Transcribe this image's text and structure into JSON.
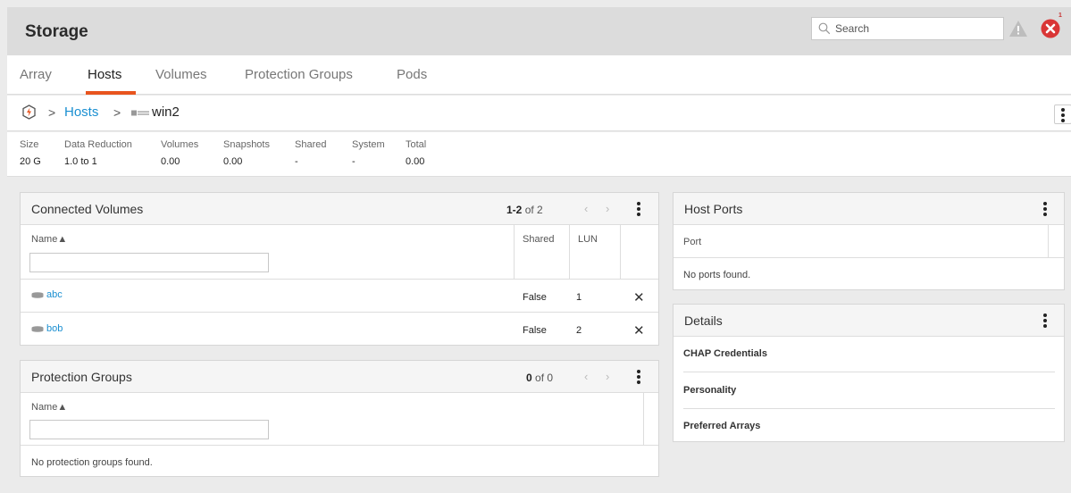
{
  "header": {
    "title": "Storage",
    "search_placeholder": "Search",
    "alert_count": "1"
  },
  "tabs": [
    {
      "label": "Array"
    },
    {
      "label": "Hosts"
    },
    {
      "label": "Volumes"
    },
    {
      "label": "Protection Groups"
    },
    {
      "label": "Pods"
    }
  ],
  "active_tab": "Hosts",
  "breadcrumb": {
    "sep": ">",
    "hosts": "Hosts",
    "current": "win2"
  },
  "stats": [
    {
      "label": "Size",
      "value": "20 G"
    },
    {
      "label": "Data Reduction",
      "value": "1.0 to 1"
    },
    {
      "label": "Volumes",
      "value": "0.00"
    },
    {
      "label": "Snapshots",
      "value": "0.00"
    },
    {
      "label": "Shared",
      "value": "-"
    },
    {
      "label": "System",
      "value": "-"
    },
    {
      "label": "Total",
      "value": "0.00"
    }
  ],
  "connected_volumes": {
    "title": "Connected Volumes",
    "range": "1-2",
    "of_total": "of 2",
    "col_name": "Name▲",
    "col_shared": "Shared",
    "col_lun": "LUN",
    "rows": [
      {
        "name": "abc",
        "shared": "False",
        "lun": "1"
      },
      {
        "name": "bob",
        "shared": "False",
        "lun": "2"
      }
    ],
    "remove_glyph": "✕"
  },
  "protection_groups": {
    "title": "Protection Groups",
    "range": "0",
    "of_total": "of 0",
    "col_name": "Name▲",
    "empty": "No protection groups found."
  },
  "host_ports": {
    "title": "Host Ports",
    "col_port": "Port",
    "empty": "No ports found."
  },
  "details": {
    "title": "Details",
    "items": [
      "CHAP Credentials",
      "Personality",
      "Preferred Arrays"
    ]
  },
  "pager_arrows": "‹ ›",
  "colors": {
    "accent": "#e8541e",
    "link": "#1a8fd1",
    "error": "#d93636"
  }
}
